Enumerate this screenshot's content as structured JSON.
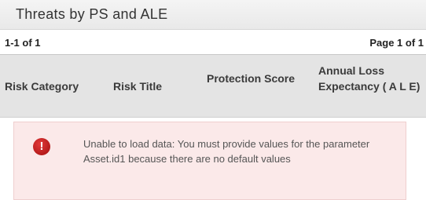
{
  "panel": {
    "title": "Threats by PS and ALE"
  },
  "pager": {
    "range": "1-1 of 1",
    "page": "Page 1 of 1"
  },
  "table": {
    "columns": [
      "Risk Category",
      "Risk Title",
      "Protection Score",
      "Annual Loss Expectancy ( A L E)"
    ]
  },
  "error": {
    "icon": "error-exclamation-icon",
    "glyph": "!",
    "message": "Unable to load data: You must provide values for the parameter Asset.id1 because there are no default values"
  },
  "colors": {
    "error_background": "#fbe9e9",
    "error_icon": "#c21e1e",
    "header_background": "#e4e4e4"
  }
}
